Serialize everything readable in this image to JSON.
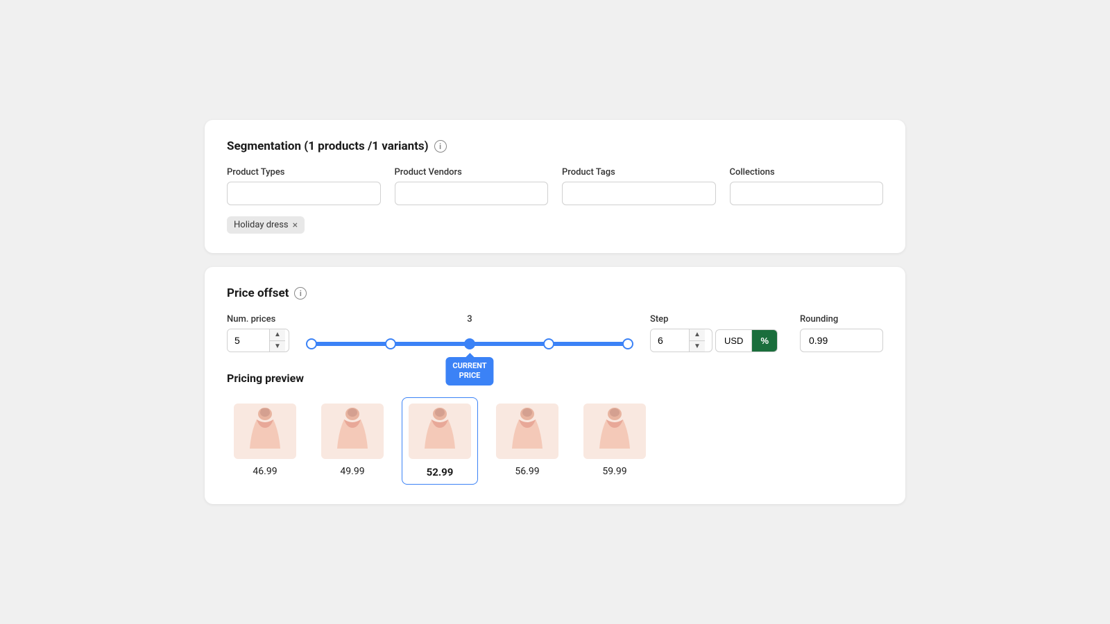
{
  "segmentation": {
    "title": "Segmentation (1 products /1 variants)",
    "info_icon": "i",
    "fields": {
      "product_types": {
        "label": "Product Types",
        "value": ""
      },
      "product_vendors": {
        "label": "Product Vendors",
        "value": ""
      },
      "product_tags": {
        "label": "Product Tags",
        "value": ""
      },
      "collections": {
        "label": "Collections",
        "value": ""
      }
    },
    "tags": [
      {
        "label": "Holiday dress",
        "removable": true
      }
    ]
  },
  "price_offset": {
    "title": "Price offset",
    "info_icon": "i",
    "num_prices": {
      "label": "Num. prices",
      "value": "5"
    },
    "slider": {
      "label": "3",
      "current_position_pct": 50,
      "thumbs_pct": [
        0,
        25,
        50,
        75,
        100
      ],
      "tooltip": "CURRENT\nPRICE"
    },
    "step": {
      "label": "Step",
      "value": "6"
    },
    "usd_label": "USD",
    "pct_label": "%",
    "rounding": {
      "label": "Rounding",
      "value": "0.99"
    }
  },
  "pricing_preview": {
    "title": "Pricing preview",
    "items": [
      {
        "price": "46.99",
        "active": false
      },
      {
        "price": "49.99",
        "active": false
      },
      {
        "price": "52.99",
        "active": true
      },
      {
        "price": "56.99",
        "active": false
      },
      {
        "price": "59.99",
        "active": false
      }
    ]
  }
}
